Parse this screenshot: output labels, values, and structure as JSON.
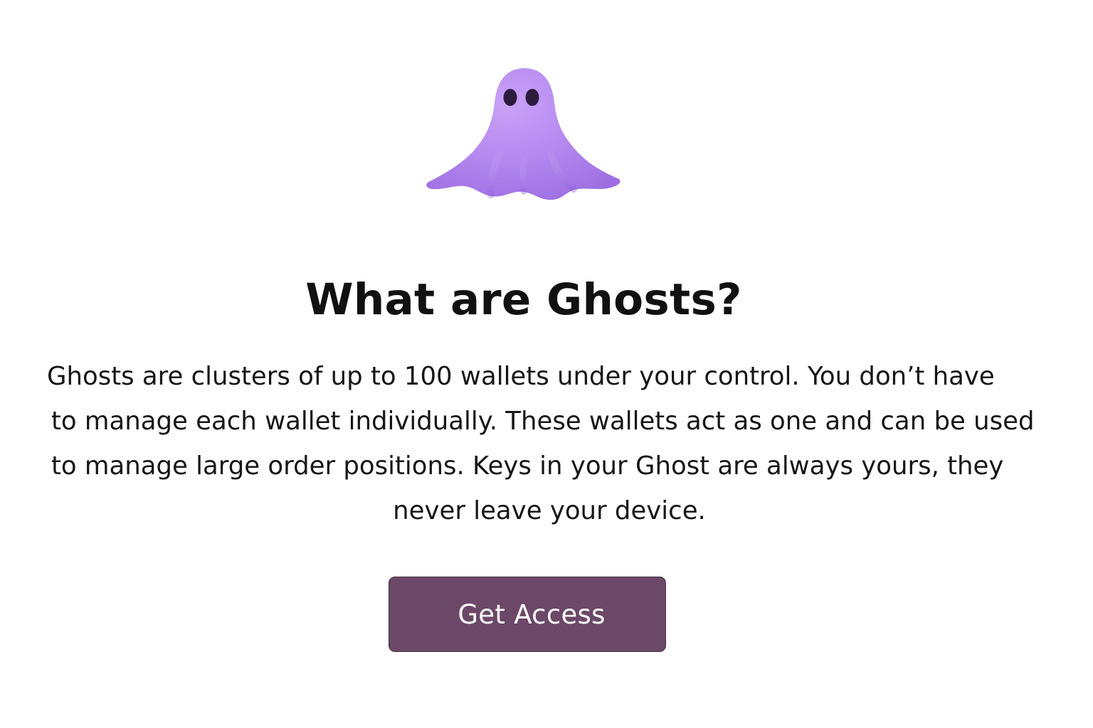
{
  "hero": {
    "icon": "ghost-icon",
    "ghost_color": "#b98cf2",
    "eye_color": "#2d1b3d"
  },
  "main": {
    "title": "What are Ghosts?",
    "description_lines": [
      "Ghosts are clusters of up to 100 wallets under your control. You don’t have",
      "to manage each wallet individually. These wallets act as one and can be used",
      "to manage large order positions. Keys in your Ghost are always yours, they",
      "never leave your device."
    ]
  },
  "cta": {
    "label": "Get Access",
    "background": "#6c4868",
    "text_color": "#ffffff"
  }
}
